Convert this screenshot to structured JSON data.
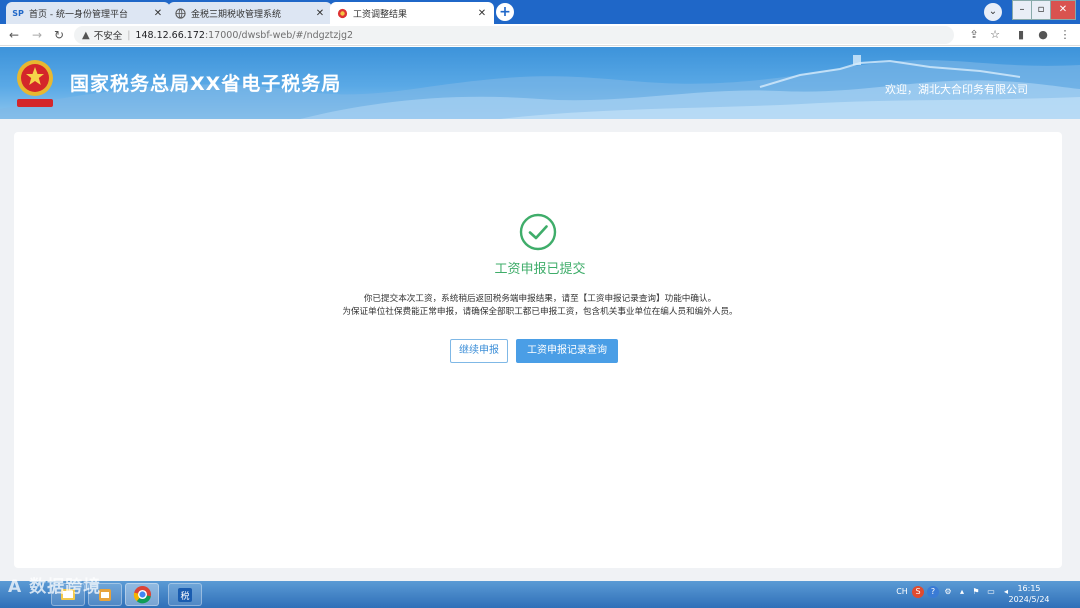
{
  "browser": {
    "tabs": [
      {
        "label": "首页 - 统一身份管理平台",
        "favicon": "SP"
      },
      {
        "label": "金税三期税收管理系统",
        "favicon": "globe"
      },
      {
        "label": "工资调整结果",
        "favicon": "emblem"
      }
    ],
    "address": {
      "security_label": "不安全",
      "host": "148.12.66.172",
      "path": ":17000/dwsbf-web/#/ndgztzjg2"
    }
  },
  "header": {
    "title": "国家税务总局XX省电子税务局",
    "welcome": "欢迎，湖北大合印务有限公司"
  },
  "result": {
    "title": "工资申报已提交",
    "message_line1": "你已提交本次工资，系统稍后返回税务端申报结果，请至【工资申报记录查询】功能中确认。",
    "message_line2": "为保证单位社保费能正常申报，请确保全部职工都已申报工资，包含机关事业单位在编人员和编外人员。",
    "status_color": "#3fad6a"
  },
  "actions": {
    "continue_label": "继续申报",
    "query_label": "工资申报记录查询"
  },
  "taskbar": {
    "watermark": "A 数据跨境",
    "tray_lang": "CH",
    "time": "16:15",
    "date": "2024/5/24"
  }
}
